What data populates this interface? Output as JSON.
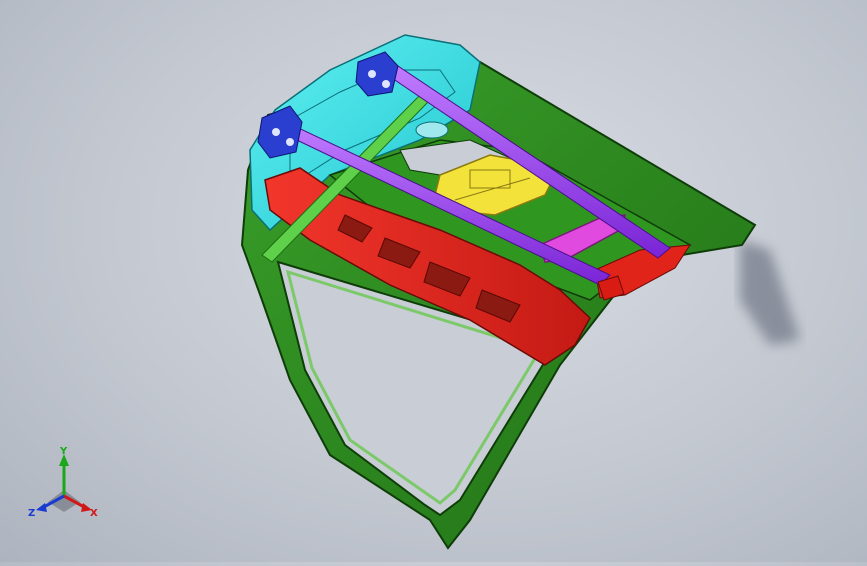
{
  "viewport": {
    "background_top": "#d9dde4",
    "background_bottom": "#aeb4bf"
  },
  "model": {
    "parts": [
      {
        "name": "outer-panel",
        "color": "#2e8b1e"
      },
      {
        "name": "inner-panel",
        "color": "#34e0e6"
      },
      {
        "name": "cross-member",
        "color": "#e8241c"
      },
      {
        "name": "support-rod",
        "color": "#9b3ff0"
      },
      {
        "name": "mount-bracket",
        "color": "#2a3ed0"
      },
      {
        "name": "latch-plate",
        "color": "#f2e23a"
      },
      {
        "name": "reinforcement-plate",
        "color": "#e04adf"
      }
    ]
  },
  "triad": {
    "y_label": "Y",
    "x_label": "X",
    "z_label": "Z",
    "y_color": "#1aa81a",
    "x_color": "#d01818",
    "z_color": "#1a3ad0"
  }
}
